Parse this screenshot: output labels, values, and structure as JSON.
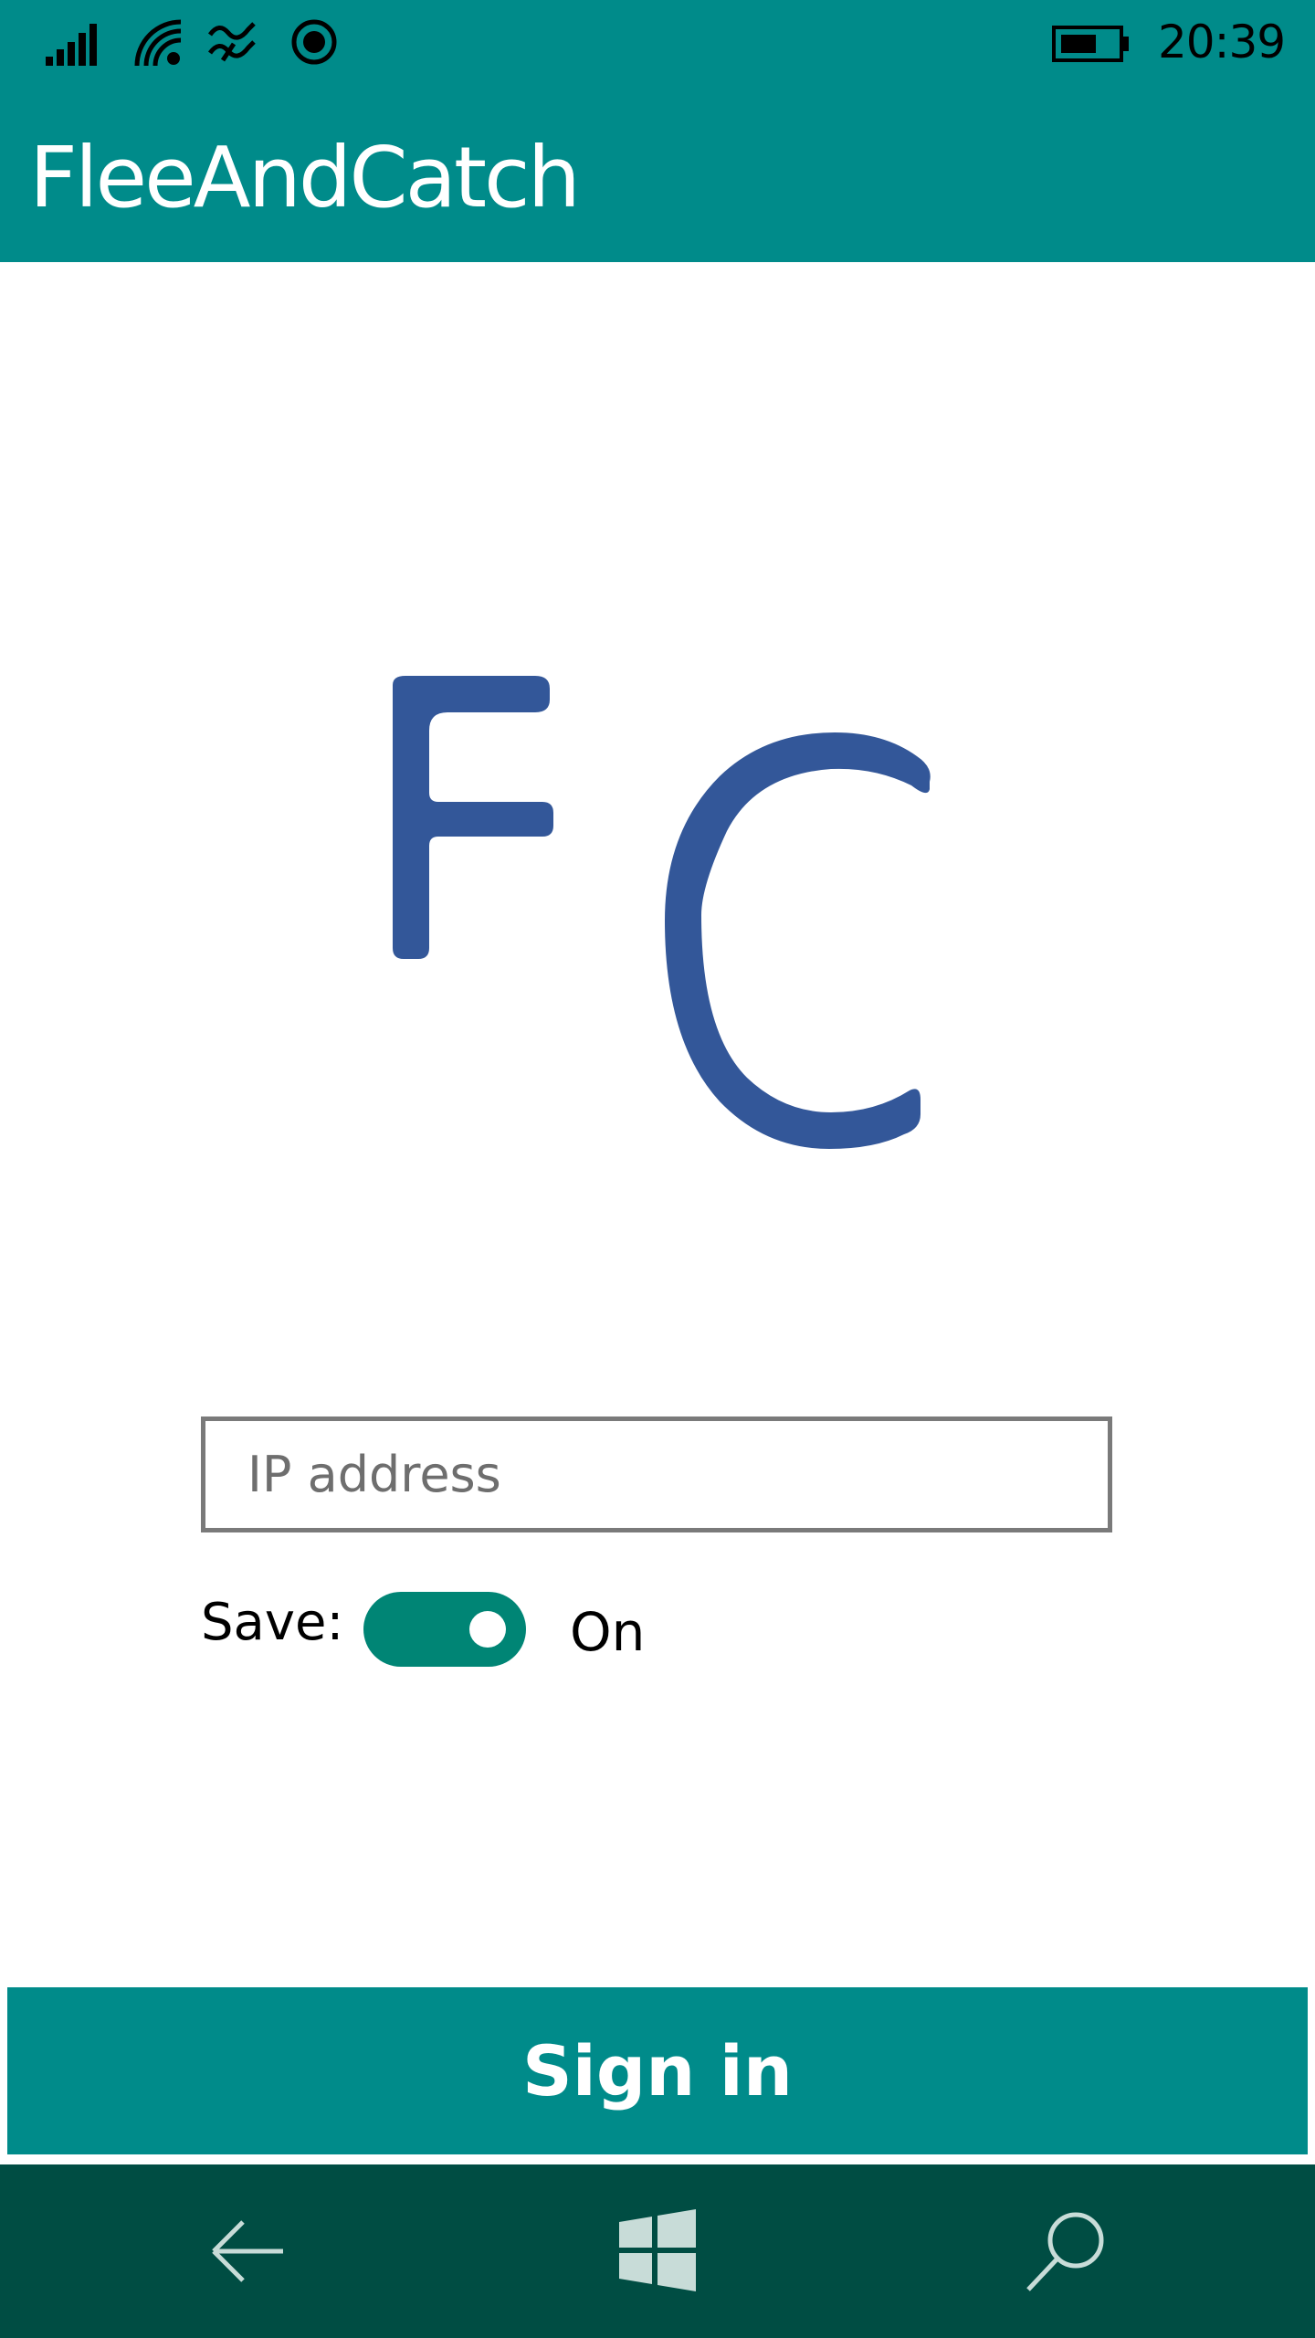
{
  "status_bar": {
    "time": "20:39",
    "icons": [
      "signal-strength-icon",
      "wifi-icon",
      "cellular-data-icon",
      "location-icon",
      "battery-icon"
    ]
  },
  "header": {
    "title": "FleeAndCatch"
  },
  "logo": {
    "text": "FC",
    "color": "#335799"
  },
  "form": {
    "ip_placeholder": "IP address",
    "ip_value": "",
    "save_label": "Save:",
    "save_toggle_state": "On",
    "save_toggle_on": true
  },
  "signin": {
    "label": "Sign in"
  },
  "nav": {
    "items": [
      "back-icon",
      "windows-start-icon",
      "search-icon"
    ]
  },
  "colors": {
    "accent": "#008b8a",
    "toggle": "#008575",
    "nav_bar": "#004d43"
  }
}
